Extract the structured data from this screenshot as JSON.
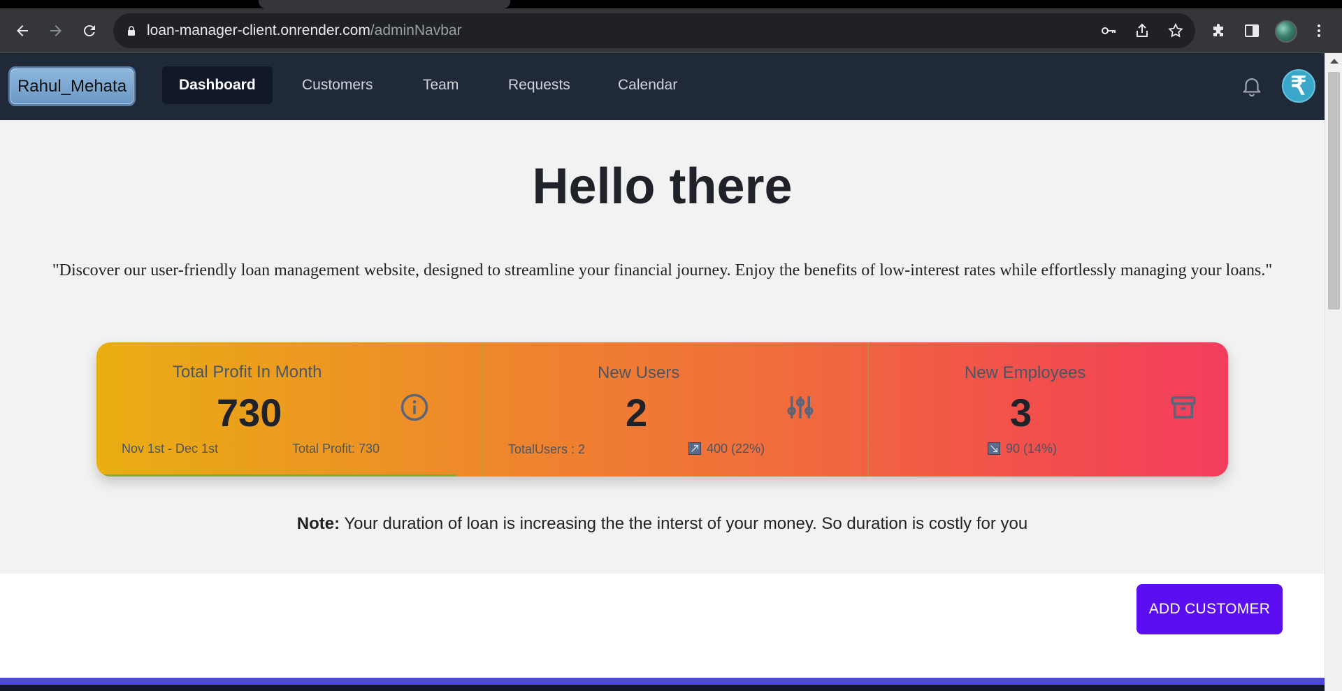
{
  "browser": {
    "url_host": "loan-manager-client.onrender.com",
    "url_path": "/adminNavbar"
  },
  "navbar": {
    "brand": "Rahul_Mehata",
    "links": [
      {
        "label": "Dashboard",
        "active": true
      },
      {
        "label": "Customers",
        "active": false
      },
      {
        "label": "Team",
        "active": false
      },
      {
        "label": "Requests",
        "active": false
      },
      {
        "label": "Calendar",
        "active": false
      }
    ],
    "avatar_symbol": "₹"
  },
  "hero": {
    "title": "Hello there",
    "text": "\"Discover our user-friendly loan management website, designed to streamline your financial journey. Enjoy the benefits of low-interest rates while effortlessly managing your loans.\""
  },
  "stats": [
    {
      "title": "Total Profit In Month",
      "value": "730",
      "left_note": "Nov 1st - Dec 1st",
      "right_note": "Total Profit: 730",
      "icon": "info-icon"
    },
    {
      "title": "New Users",
      "value": "2",
      "left_note": "TotalUsers : 2",
      "right_note": "400 (22%)",
      "trend": "up",
      "icon": "sliders-icon"
    },
    {
      "title": "New Employees",
      "value": "3",
      "right_note": "90 (14%)",
      "trend": "down",
      "icon": "archive-icon"
    }
  ],
  "note": {
    "label": "Note:",
    "text": " Your duration of loan is increasing the the interst of your money. So duration is costly for you"
  },
  "actions": {
    "add_customer": "ADD CUSTOMER"
  },
  "colors": {
    "navbar_bg": "#1f2937",
    "add_button": "#5b0ff0",
    "gradient_start": "#e9ae12",
    "gradient_end": "#f43d5e"
  }
}
